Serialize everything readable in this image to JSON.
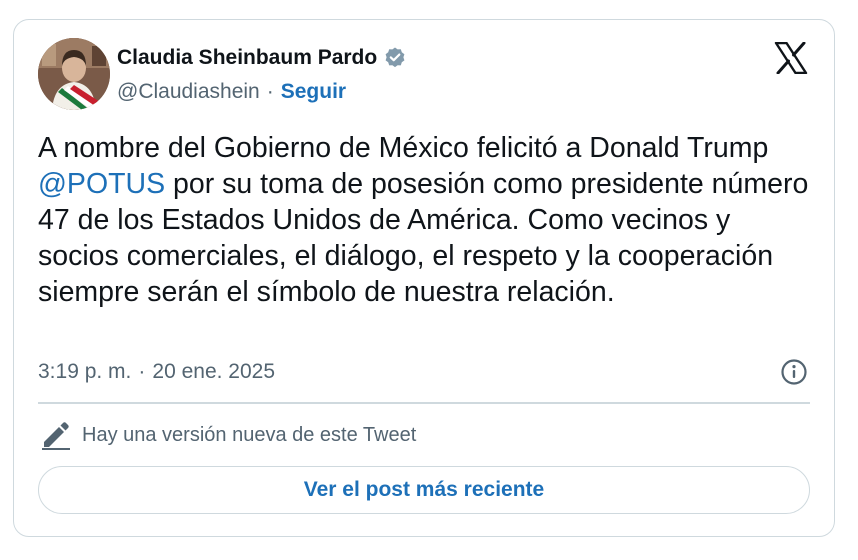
{
  "author": {
    "display_name": "Claudia Sheinbaum Pardo",
    "handle": "@Claudiashein",
    "separator": "·",
    "follow_label": "Seguir",
    "avatar_icon": "profile-photo",
    "verified_icon": "verified-badge-icon"
  },
  "tweet": {
    "text_before": "A nombre del Gobierno de México felicitó a Donald Trump ",
    "mention": "@POTUS",
    "text_after": " por su toma de posesión como presidente número 47 de los Estados Unidos de América. Como vecinos y socios comerciales, el diálogo, el respeto y la cooperación siempre serán el símbolo de nuestra relación."
  },
  "meta": {
    "time": "3:19 p. m.",
    "separator": "·",
    "date": "20 ene. 2025"
  },
  "notice": {
    "text": "Hay una versión nueva de este Tweet",
    "icon": "pencil-icon"
  },
  "cta": {
    "label": "Ver el post más reciente"
  },
  "colors": {
    "accent": "#1d70b8",
    "text": "#0f1419",
    "secondary": "#536471",
    "border": "#cfd9de"
  }
}
